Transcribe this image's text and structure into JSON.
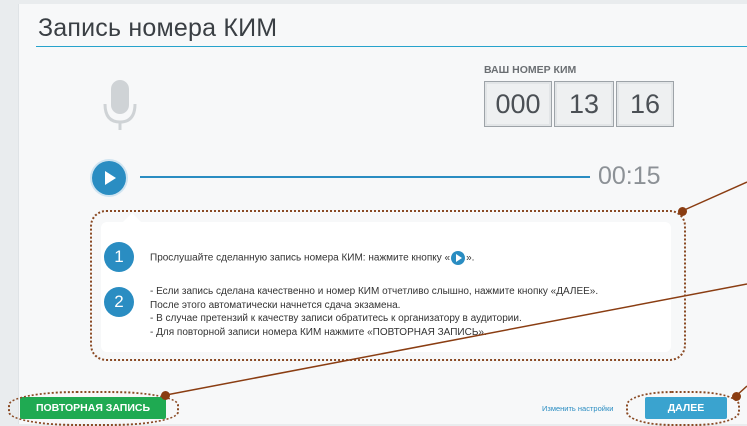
{
  "page": {
    "title": "Запись номера КИМ"
  },
  "kim": {
    "caption": "ВАШ НОМЕР КИМ",
    "parts": [
      "000",
      "13",
      "16"
    ]
  },
  "player": {
    "time": "00:15"
  },
  "instructions": {
    "step1_number": "1",
    "step1_text_before": "Прослушайте сделанную запись номера КИМ: нажмите кнопку «",
    "step1_text_after": "».",
    "step2_number": "2",
    "step2_lines": [
      "- Если запись сделана качественно и номер КИМ отчетливо слышно, нажмите кнопку «ДАЛЕЕ».",
      "После этого автоматически начнется сдача экзамена.",
      "- В случае претензий к качеству записи обратитесь к организатору в аудитории.",
      "- Для повторной записи номера КИМ нажмите «ПОВТОРНАЯ ЗАПИСЬ»."
    ]
  },
  "footer": {
    "repeat_label": "ПОВТОРНАЯ ЗАПИСЬ",
    "settings_link": "Изменить настройки",
    "next_label": "ДАЛЕЕ"
  },
  "icons": {
    "microphone": "microphone-icon",
    "play": "play-icon"
  },
  "colors": {
    "accent": "#2a8dc2",
    "repeat_button": "#1faa52",
    "next_button": "#3aa3cf",
    "annotation": "#8a4a24"
  }
}
